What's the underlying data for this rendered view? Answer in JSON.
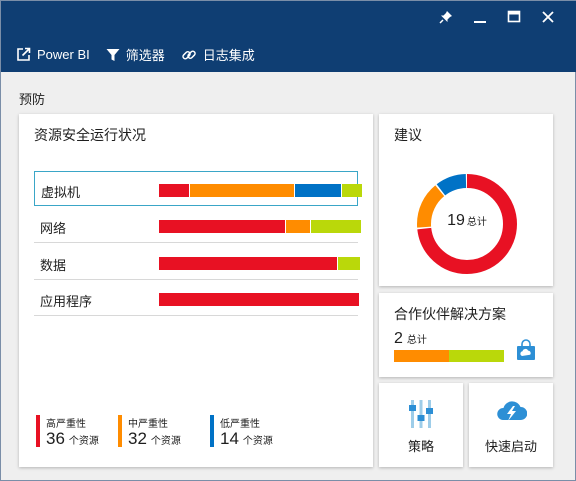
{
  "toolbar": {
    "items": [
      {
        "label": "Power BI",
        "icon": "external-link-icon"
      },
      {
        "label": "筛选器",
        "icon": "filter-icon"
      },
      {
        "label": "日志集成",
        "icon": "link-icon"
      }
    ]
  },
  "window_controls": [
    "pin-icon",
    "minimize-icon",
    "maximize-icon",
    "close-icon"
  ],
  "section": {
    "title": "预防"
  },
  "health": {
    "title": "资源安全运行状况",
    "rows": [
      {
        "label": "虚拟机",
        "selected": true,
        "segments": {
          "high": 30,
          "medium": 104,
          "low": 46,
          "informational": 20
        }
      },
      {
        "label": "网络",
        "selected": false,
        "segments": {
          "high": 126,
          "medium": 24,
          "low": 0,
          "informational": 50
        }
      },
      {
        "label": "数据",
        "selected": false,
        "segments": {
          "high": 178,
          "medium": 0,
          "low": 0,
          "informational": 22
        }
      },
      {
        "label": "应用程序",
        "selected": false,
        "segments": {
          "high": 200,
          "medium": 0,
          "low": 0,
          "informational": 0
        }
      }
    ],
    "legend": [
      {
        "name": "高严重性",
        "count": "36",
        "unit": "个资源",
        "color": "#e81123"
      },
      {
        "name": "中严重性",
        "count": "32",
        "unit": "个资源",
        "color": "#ff8c00"
      },
      {
        "name": "低严重性",
        "count": "14",
        "unit": "个资源",
        "color": "#0072c6"
      }
    ]
  },
  "colors": {
    "high": "#e81123",
    "medium": "#ff8c00",
    "low": "#0072c6",
    "informational": "#bad80a",
    "header": "#0f3e73"
  },
  "recommendations": {
    "title": "建议",
    "total": "19",
    "total_label": "总计",
    "slices": [
      {
        "severity": "high",
        "value": 14
      },
      {
        "severity": "medium",
        "value": 3
      },
      {
        "severity": "low",
        "value": 2
      }
    ]
  },
  "partner": {
    "title": "合作伙伴解决方案",
    "count": "2",
    "count_label": "总计",
    "bar": {
      "medium": 1,
      "informational": 1
    },
    "icon": "shopping-bag-icon"
  },
  "tiles": {
    "policy": {
      "label": "策略",
      "icon": "sliders-icon"
    },
    "quickstart": {
      "label": "快速启动",
      "icon": "cloud-lightning-icon"
    }
  }
}
